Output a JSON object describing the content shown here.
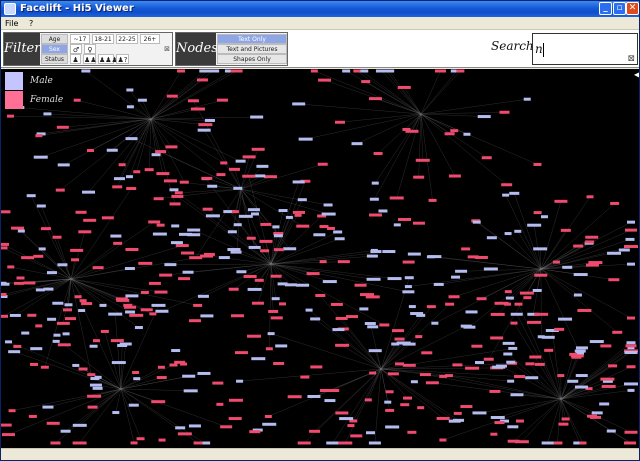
{
  "window": {
    "title": "Facelift - Hi5 Viewer",
    "controls": {
      "minimize": "_",
      "maximize": "▫",
      "close": "✕"
    }
  },
  "menu": {
    "items": [
      "File",
      "?"
    ]
  },
  "filter": {
    "label": "Filter",
    "rows": [
      {
        "label": "Age",
        "options": [
          "~17",
          "18-21",
          "22-25",
          "26+"
        ]
      },
      {
        "label": "Sex",
        "options": [
          "♂",
          "♀"
        ]
      },
      {
        "label": "Status",
        "options": [
          "♟",
          "♟♟",
          "♟♟♟",
          "♟?"
        ]
      }
    ],
    "clear_icon": "⊠"
  },
  "nodes": {
    "label": "Nodes",
    "options": [
      "Text Only",
      "Text and Pictures",
      "Shapes Only"
    ],
    "selected": "Text Only"
  },
  "search": {
    "label": "Search",
    "value": "n",
    "clear_icon": "⊠"
  },
  "legend": [
    {
      "label": "Male",
      "color": "#c4c4ff"
    },
    {
      "label": "Female",
      "color": "#ff6f96"
    }
  ],
  "graph": {
    "background": "#000000",
    "male_node_color": "#b4bcf0",
    "female_node_color": "#f04a6e",
    "edge_color": "#8a8a8a"
  }
}
